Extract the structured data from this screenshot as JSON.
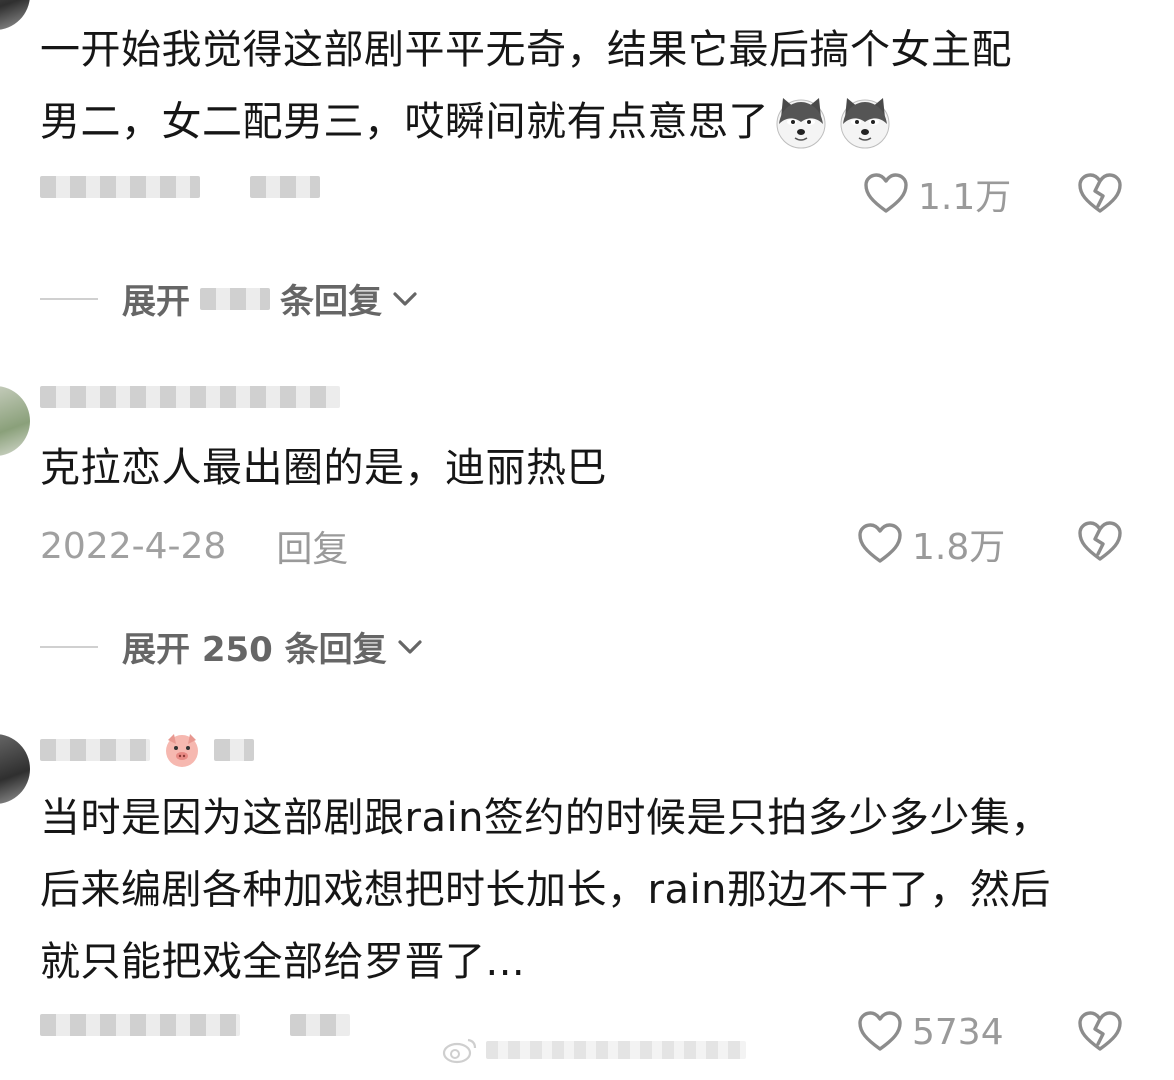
{
  "comments": [
    {
      "text_line1": "一开始我觉得这部剧平平无奇，结果它最后搞个女主配",
      "text_line2": "男二，女二配男三，哎瞬间就有点意思了",
      "likes": "1.1万",
      "expand_label": "展开",
      "expand_suffix": "条回复"
    },
    {
      "text": "克拉恋人最出圈的是，迪丽热巴",
      "date": "2022-4-28",
      "reply": "回复",
      "likes": "1.8万",
      "expand_label": "展开 250 条回复"
    },
    {
      "text_line1": "当时是因为这部剧跟rain签约的时候是只拍多少多少集，",
      "text_line2": "后来编剧各种加戏想把时长加长，rain那边不干了，然后",
      "text_line3": "就只能把戏全部给罗晋了...",
      "likes": "5734"
    }
  ],
  "icons": {
    "like": "heart-outline-icon",
    "dislike": "broken-heart-icon",
    "expand": "chevron-down-icon",
    "emoji": "husky-dog-emoji",
    "badge": "pig-emoji"
  },
  "colors": {
    "text": "#161616",
    "meta": "#a0a0a0",
    "icon": "#9a9a9a"
  }
}
